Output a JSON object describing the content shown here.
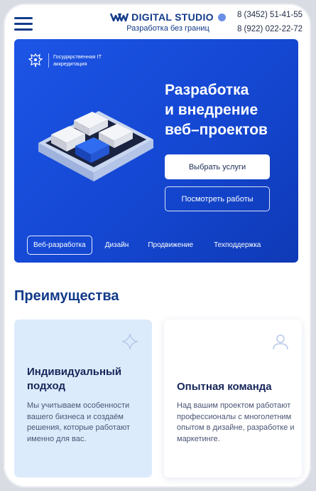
{
  "header": {
    "brand_name": "DIGITAL STUDIO",
    "tagline": "Разработка без границ",
    "phone_1": "8 (3452) 51-41-55",
    "phone_2": "8 (922) 022-22-72"
  },
  "hero": {
    "accreditation_label": "Государственная IT аккредитация",
    "title_line_1": "Разработка",
    "title_line_2": "и внедрение",
    "title_line_3": "веб–проектов",
    "primary_button": "Выбрать услуги",
    "secondary_button": "Посмотреть работы",
    "tabs": [
      {
        "label": "Веб-разработка",
        "active": true
      },
      {
        "label": "Дизайн",
        "active": false
      },
      {
        "label": "Продвижение",
        "active": false
      },
      {
        "label": "Техподдержка",
        "active": false
      }
    ]
  },
  "advantages": {
    "title": "Преимущества",
    "cards": [
      {
        "title": "Индивидуальный подход",
        "text": "Мы учитываем особенности вашего бизнеса и создаём решения, которые работают именно для вас.",
        "icon": "sparkle-icon"
      },
      {
        "title": "Опытная команда",
        "text": "Над вашим проектом работают профессионалы с многолетним опытом в дизайне, разработке и маркетинге.",
        "icon": "user-icon"
      }
    ]
  },
  "colors": {
    "brand": "#123a8a",
    "hero_bg": "#1447d2",
    "card_highlight": "#dcebfb"
  }
}
